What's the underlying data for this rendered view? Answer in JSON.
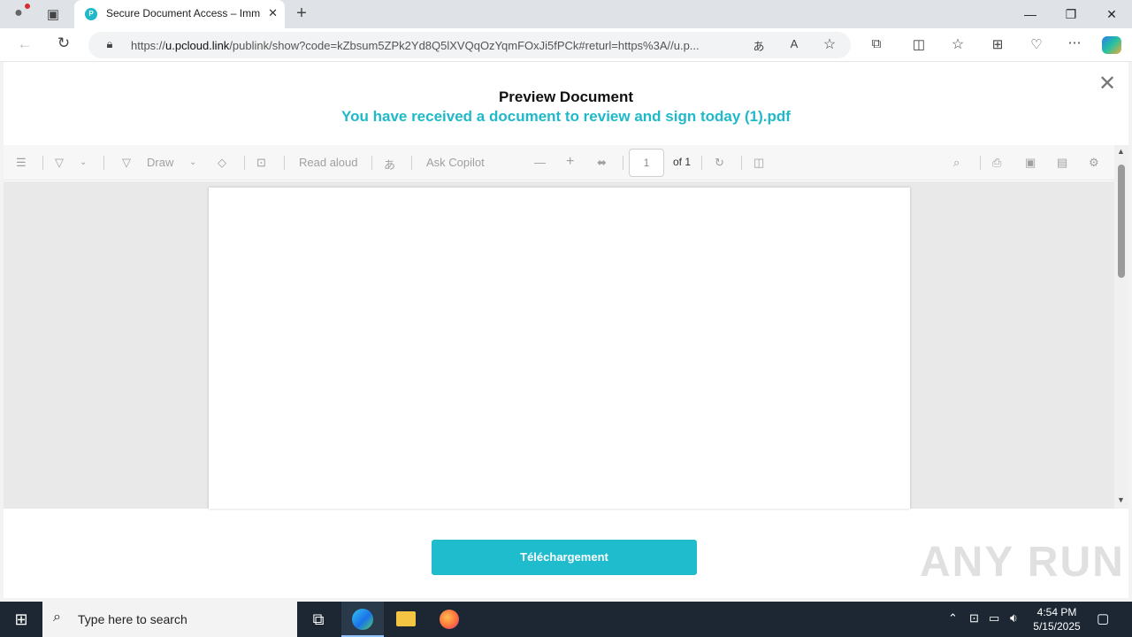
{
  "browser": {
    "tab_title": "Secure Document Access – Imm",
    "url_prefix": "https://",
    "url_host": "u.pcloud.link",
    "url_rest": "/publink/show?code=kZbsum5ZPk2Yd8Q5lXVQqOzYqmFOxJi5fPCk#returl=https%3A//u.p..."
  },
  "modal": {
    "title": "Preview Document",
    "subtitle": "You have received a document to review and sign today (1).pdf"
  },
  "pdf_toolbar": {
    "draw": "Draw",
    "read_aloud": "Read aloud",
    "ask_copilot": "Ask Copilot",
    "page": "1",
    "of": "of 1"
  },
  "download_button": "Téléchargement",
  "watermark": "ANY RUN",
  "taskbar": {
    "search_placeholder": "Type here to search",
    "time": "4:54 PM",
    "date": "5/15/2025"
  },
  "colors": {
    "accent": "#1ebccd",
    "subtitle": "#20b9c9"
  }
}
